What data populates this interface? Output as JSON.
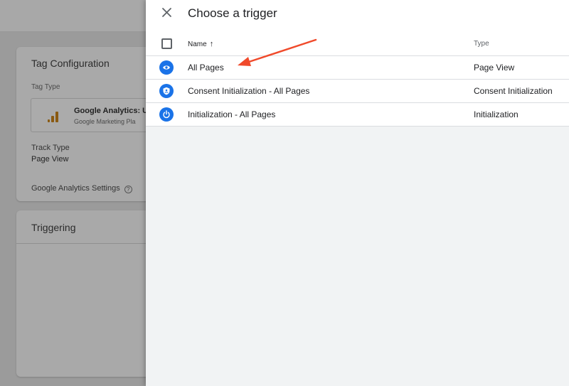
{
  "background": {
    "tag_configuration": {
      "title": "Tag Configuration",
      "tag_type_label": "Tag Type",
      "tag_type_name": "Google Analytics: U",
      "tag_type_sub": "Google Marketing Pla",
      "track_type_label": "Track Type",
      "track_type_value": "Page View",
      "ga_settings_label": "Google Analytics Settings"
    },
    "triggering": {
      "title": "Triggering"
    }
  },
  "panel": {
    "title": "Choose a trigger",
    "columns": {
      "name": "Name",
      "type": "Type"
    },
    "triggers": [
      {
        "name": "All Pages",
        "type": "Page View",
        "icon": "eye-icon"
      },
      {
        "name": "Consent Initialization - All Pages",
        "type": "Consent Initialization",
        "icon": "shield-icon"
      },
      {
        "name": "Initialization - All Pages",
        "type": "Initialization",
        "icon": "power-icon"
      }
    ]
  },
  "colors": {
    "accent": "#1a73e8",
    "annotation_arrow": "#f04a2b"
  }
}
